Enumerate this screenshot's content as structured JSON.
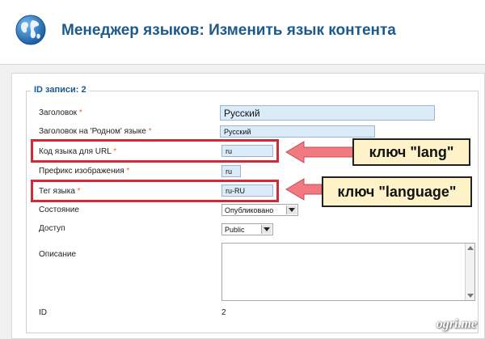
{
  "header": {
    "title": "Менеджер языков: Изменить язык контента",
    "icon": "globe-icon"
  },
  "form": {
    "legend": "ID записи: 2",
    "required_mark": "*",
    "fields": {
      "title": {
        "label": "Заголовок",
        "value": "Русский"
      },
      "title_native": {
        "label": "Заголовок на 'Родном' языке",
        "value": "Русский"
      },
      "url_code": {
        "label": "Код языка для URL",
        "value": "ru"
      },
      "image_prefix": {
        "label": "Префикс изображения",
        "value": "ru"
      },
      "lang_tag": {
        "label": "Тег языка",
        "value": "ru-RU"
      },
      "state": {
        "label": "Состояние",
        "value": "Опубликовано"
      },
      "access": {
        "label": "Доступ",
        "value": "Public"
      },
      "description": {
        "label": "Описание",
        "value": ""
      },
      "id": {
        "label": "ID",
        "value": "2"
      }
    }
  },
  "annotations": {
    "callout_lang": "ключ \"lang\"",
    "callout_language": "ключ \"language\"",
    "highlight_color": "#d12a35",
    "arrow_color": "#f07a80",
    "callout_bg": "#fef3c8"
  },
  "watermark": "ogri.me"
}
